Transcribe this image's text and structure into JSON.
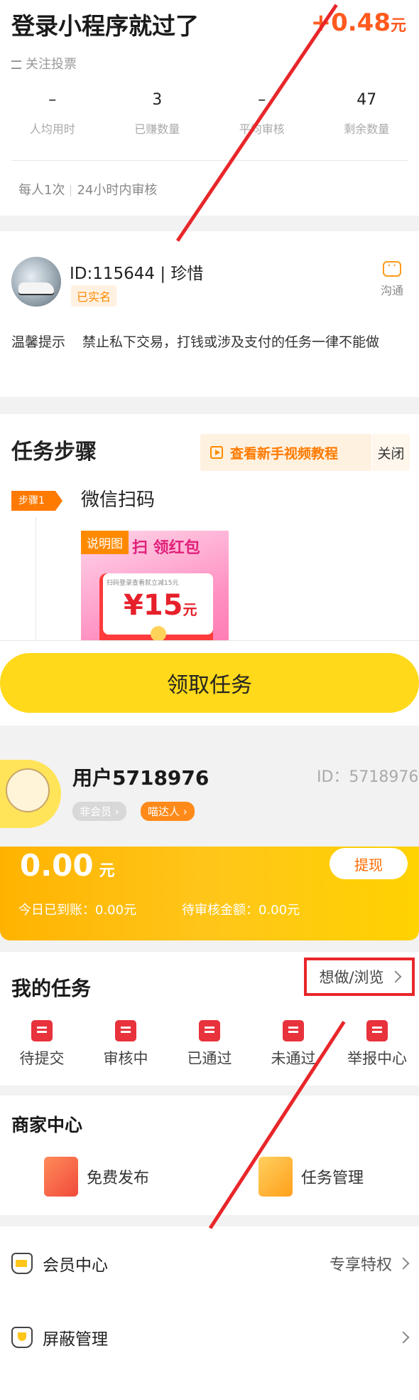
{
  "task": {
    "title": "登录小程序就过了",
    "reward": "+0.48",
    "reward_unit": "元",
    "follow_label": "关注投票",
    "stats": [
      {
        "value": "–",
        "label": "人均用时"
      },
      {
        "value": "3",
        "label": "已赚数量"
      },
      {
        "value": "–",
        "label": "平均审核"
      },
      {
        "value": "47",
        "label": "剩余数量"
      }
    ],
    "limit_1": "每人1次",
    "limit_2": "24小时内审核"
  },
  "publisher": {
    "id_text": "ID:115644 | 珍惜",
    "verified": "已实名",
    "chat_label": "沟通",
    "notice_key": "温馨提示",
    "notice_text": "禁止私下交易，打钱或涉及支付的任务一律不能做"
  },
  "steps": {
    "title": "任务步骤",
    "tutorial_label": "查看新手视频教程",
    "close_label": "关闭",
    "step_badge": "步骤1",
    "step_name": "微信扫码",
    "explain_tag": "说明图",
    "explain_head": "扫 领红包",
    "explain_small": "扫码登录查看就立减15元",
    "explain_amount": "¥15",
    "explain_amount_unit": "元"
  },
  "claim_button": "领取任务",
  "user": {
    "name": "用户5718976",
    "id_text": "ID：5718976",
    "badge_1": "非会员",
    "badge_2": "喵达人"
  },
  "wallet": {
    "amount": "0.00",
    "unit": "元",
    "today": "今日已到账：0.00元",
    "pending": "待审核金额：0.00元",
    "withdraw": "提现"
  },
  "my_tasks": {
    "title": "我的任务",
    "link": "想做/浏览",
    "items": [
      {
        "label": "待提交",
        "icon": "upload-doc-icon"
      },
      {
        "label": "审核中",
        "icon": "review-icon"
      },
      {
        "label": "已通过",
        "icon": "approved-icon"
      },
      {
        "label": "未通过",
        "icon": "rejected-icon"
      },
      {
        "label": "举报中心",
        "icon": "report-icon"
      }
    ]
  },
  "merchant": {
    "title": "商家中心",
    "item_1": "免费发布",
    "item_2": "任务管理"
  },
  "menu": {
    "vip": "会员中心",
    "vip_extra": "专享特权",
    "block": "屏蔽管理"
  },
  "colors": {
    "accent": "#ffd91a",
    "reward": "#ff5a1f",
    "annotation": "#e8262a"
  }
}
